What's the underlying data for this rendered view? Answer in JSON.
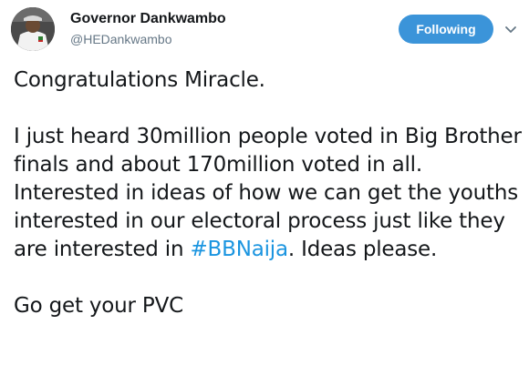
{
  "author": {
    "name": "Governor Dankwambo",
    "handle": "@HEDankwambo",
    "avatar_icon": "profile-photo-icon"
  },
  "follow_button": {
    "label": "Following",
    "color": "#3b94d9"
  },
  "menu": {
    "icon": "chevron-down-icon"
  },
  "tweet": {
    "line1": "Congratulations Miracle.",
    "para2_before": "I just heard 30million people voted in Big Brother finals and about 170million voted in all. Interested in ideas of how we can get the youths interested in our electoral process just like they are interested in ",
    "hashtag": "#BBNaija",
    "para2_after": ". Ideas please.",
    "line3": "Go get your PVC",
    "hashtag_color": "#1b95e0"
  }
}
